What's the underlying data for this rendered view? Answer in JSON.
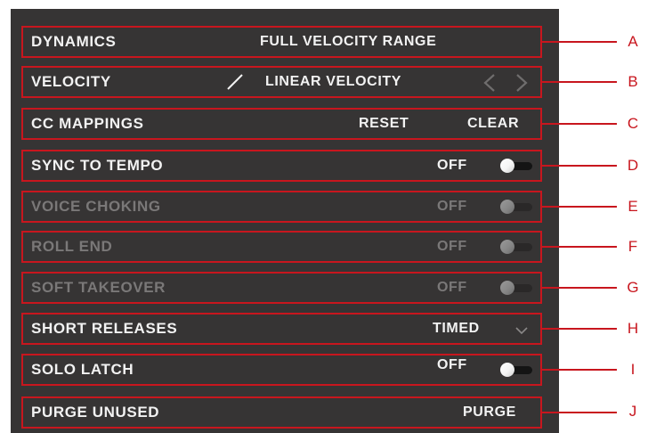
{
  "panel": {
    "dynamics": {
      "label": "DYNAMICS",
      "value": "FULL VELOCITY RANGE"
    },
    "velocity": {
      "label": "VELOCITY",
      "value": "LINEAR VELOCITY",
      "curve_icon": "linear-curve-icon"
    },
    "cc_mappings": {
      "label": "CC MAPPINGS",
      "reset_label": "RESET",
      "clear_label": "CLEAR"
    },
    "sync_to_tempo": {
      "label": "SYNC TO TEMPO",
      "state": "OFF",
      "enabled": true
    },
    "voice_choking": {
      "label": "VOICE CHOKING",
      "state": "OFF",
      "enabled": false
    },
    "roll_end": {
      "label": "ROLL END",
      "state": "OFF",
      "enabled": false
    },
    "soft_takeover": {
      "label": "SOFT TAKEOVER",
      "state": "OFF",
      "enabled": false
    },
    "short_releases": {
      "label": "SHORT RELEASES",
      "value": "TIMED"
    },
    "solo_latch": {
      "label": "SOLO LATCH",
      "state": "OFF",
      "enabled": true
    },
    "purge_unused": {
      "label": "PURGE UNUSED",
      "button_label": "PURGE"
    }
  },
  "callouts": [
    "A",
    "B",
    "C",
    "D",
    "E",
    "F",
    "G",
    "H",
    "I",
    "J"
  ],
  "colors": {
    "panel_bg": "#363434",
    "callout_red": "#c8161e",
    "text": "#f2f2f2",
    "disabled_text": "#7a7878"
  }
}
